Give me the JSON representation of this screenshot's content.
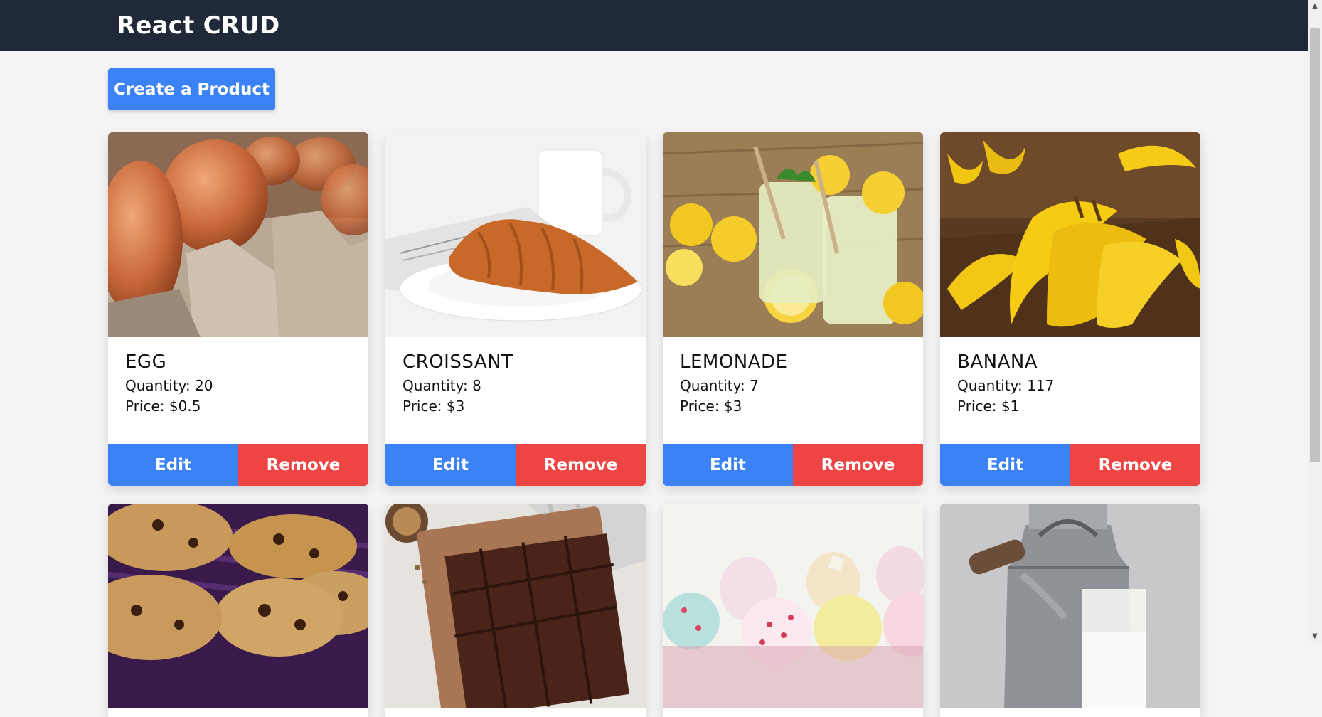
{
  "header": {
    "title": "React CRUD"
  },
  "toolbar": {
    "create_label": "Create a Product"
  },
  "products": [
    {
      "name": "EGG",
      "quantity": "Quantity: 20",
      "price": "Price: $0.5",
      "image": "eggs-in-carton"
    },
    {
      "name": "CROISSANT",
      "quantity": "Quantity: 8",
      "price": "Price: $3",
      "image": "croissant-on-plate"
    },
    {
      "name": "LEMONADE",
      "quantity": "Quantity: 7",
      "price": "Price: $3",
      "image": "lemonade-jars"
    },
    {
      "name": "BANANA",
      "quantity": "Quantity: 117",
      "price": "Price: $1",
      "image": "banana-bunches"
    },
    {
      "image": "chocolate-chip-cookies"
    },
    {
      "image": "brownies-on-board"
    },
    {
      "image": "cupcakes"
    },
    {
      "image": "milk-can-and-glass"
    }
  ],
  "card_actions": {
    "edit_label": "Edit",
    "remove_label": "Remove"
  },
  "colors": {
    "header_bg": "#1f2937",
    "primary": "#3b82f6",
    "danger": "#ef4444",
    "page_bg": "#f4f4f4"
  }
}
